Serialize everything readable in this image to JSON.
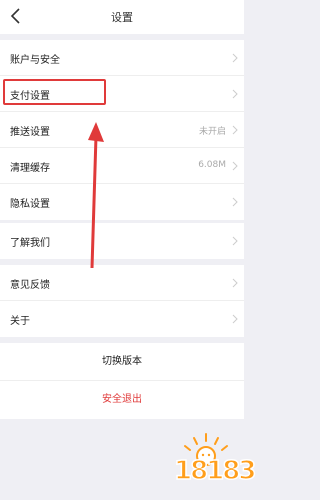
{
  "header": {
    "title": "设置"
  },
  "group1": {
    "items": [
      {
        "label": "账户与安全",
        "value": ""
      },
      {
        "label": "支付设置",
        "value": ""
      },
      {
        "label": "推送设置",
        "value": "未开启"
      },
      {
        "label": "清理缓存",
        "value": "6.08M"
      },
      {
        "label": "隐私设置",
        "value": ""
      }
    ]
  },
  "group2": {
    "items": [
      {
        "label": "了解我们",
        "value": ""
      }
    ]
  },
  "group3": {
    "items": [
      {
        "label": "意见反馈",
        "value": ""
      },
      {
        "label": "关于",
        "value": ""
      }
    ]
  },
  "actions": {
    "switch_version": "切换版本",
    "logout": "安全退出"
  },
  "watermark": {
    "text": "18183"
  },
  "colors": {
    "annotation": "#e03a3a",
    "logout": "#e03a3a",
    "watermark": "#ff9e1b"
  }
}
